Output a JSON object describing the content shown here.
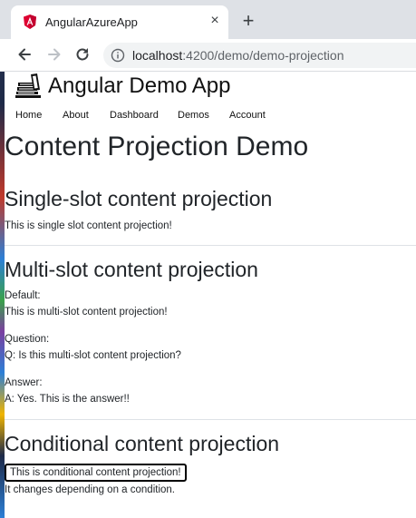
{
  "browser": {
    "tab_title": "AngularAzureApp",
    "close_tab_symbol": "×",
    "new_tab_symbol": "+",
    "url_host": "localhost",
    "url_path": ":4200/demo/demo-projection",
    "icons": [
      "angular-icon",
      "close-icon",
      "plus-icon",
      "back-arrow-icon",
      "forward-arrow-icon",
      "reload-icon",
      "info-icon"
    ]
  },
  "app": {
    "title": "Angular Demo App",
    "nav": [
      "Home",
      "About",
      "Dashboard",
      "Demos",
      "Account"
    ]
  },
  "main": {
    "page_title": "Content Projection Demo",
    "single": {
      "title": "Single-slot content projection",
      "text": "This is single slot content projection!"
    },
    "multi": {
      "title": "Multi-slot content projection",
      "default_label": "Default:",
      "default_text": "This is multi-slot content projection!",
      "question_label": "Question:",
      "question_text": "Q: Is this multi-slot content projection?",
      "answer_label": "Answer:",
      "answer_text": "A: Yes. This is the answer!!"
    },
    "conditional": {
      "title": "Conditional content projection",
      "boxed_text": "This is conditional content projection!",
      "note": "It changes depending on a condition."
    }
  },
  "colors": {
    "tabbar_bg": "#dee1e6",
    "angular_red": "#dd0031",
    "text": "#212529"
  }
}
